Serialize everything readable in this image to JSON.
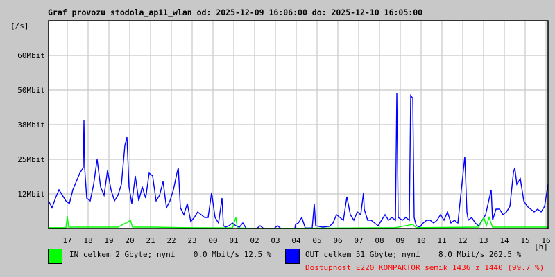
{
  "chart_data": {
    "type": "line",
    "title": "Graf provozu stodola_ap11_wlan od: 2025-12-09 16:06:00 do: 2025-12-10 16:05:00",
    "ylabel": "[/s]",
    "xlabel": "[h]",
    "x_units": "minutes since 16:06",
    "xlim": [
      0,
      1440
    ],
    "ylim": [
      0,
      75
    ],
    "y_unit": "Mbit/s",
    "grid": true,
    "yticks": [
      {
        "value": 12.5,
        "label": "12Mbit"
      },
      {
        "value": 25,
        "label": "25Mbit"
      },
      {
        "value": 37.5,
        "label": "38Mbit"
      },
      {
        "value": 50,
        "label": "50Mbit"
      },
      {
        "value": 62.5,
        "label": "60Mbit"
      }
    ],
    "xticks": [
      {
        "value": 54,
        "label": "17"
      },
      {
        "value": 114,
        "label": "18"
      },
      {
        "value": 174,
        "label": "19"
      },
      {
        "value": 234,
        "label": "20"
      },
      {
        "value": 294,
        "label": "21"
      },
      {
        "value": 354,
        "label": "22"
      },
      {
        "value": 414,
        "label": "23"
      },
      {
        "value": 474,
        "label": "00"
      },
      {
        "value": 534,
        "label": "01"
      },
      {
        "value": 594,
        "label": "02"
      },
      {
        "value": 654,
        "label": "03"
      },
      {
        "value": 714,
        "label": "04"
      },
      {
        "value": 774,
        "label": "05"
      },
      {
        "value": 834,
        "label": "06"
      },
      {
        "value": 894,
        "label": "07"
      },
      {
        "value": 954,
        "label": "08"
      },
      {
        "value": 1014,
        "label": "09"
      },
      {
        "value": 1074,
        "label": "10"
      },
      {
        "value": 1134,
        "label": "11"
      },
      {
        "value": 1194,
        "label": "12"
      },
      {
        "value": 1254,
        "label": "13"
      },
      {
        "value": 1314,
        "label": "14"
      },
      {
        "value": 1374,
        "label": "15"
      },
      {
        "value": 1434,
        "label": "16"
      }
    ],
    "series": [
      {
        "name": "OUT",
        "color": "#0000ff",
        "points": [
          [
            0,
            10
          ],
          [
            10,
            7.5
          ],
          [
            20,
            11
          ],
          [
            30,
            14
          ],
          [
            40,
            12
          ],
          [
            50,
            10
          ],
          [
            60,
            9
          ],
          [
            70,
            14
          ],
          [
            80,
            17
          ],
          [
            90,
            20
          ],
          [
            100,
            22
          ],
          [
            102,
            39
          ],
          [
            104,
            22
          ],
          [
            110,
            11
          ],
          [
            120,
            10
          ],
          [
            130,
            16
          ],
          [
            140,
            25
          ],
          [
            150,
            15
          ],
          [
            160,
            12
          ],
          [
            170,
            21
          ],
          [
            180,
            14
          ],
          [
            190,
            10
          ],
          [
            200,
            12
          ],
          [
            210,
            16
          ],
          [
            220,
            30
          ],
          [
            226,
            33
          ],
          [
            232,
            15
          ],
          [
            240,
            9
          ],
          [
            250,
            19
          ],
          [
            260,
            10
          ],
          [
            270,
            15
          ],
          [
            280,
            11
          ],
          [
            290,
            20
          ],
          [
            300,
            19
          ],
          [
            310,
            10
          ],
          [
            320,
            12
          ],
          [
            330,
            17
          ],
          [
            340,
            7.5
          ],
          [
            350,
            10
          ],
          [
            360,
            14
          ],
          [
            370,
            20
          ],
          [
            374,
            22
          ],
          [
            380,
            7.5
          ],
          [
            390,
            5
          ],
          [
            400,
            9
          ],
          [
            410,
            2.5
          ],
          [
            420,
            4
          ],
          [
            430,
            6
          ],
          [
            440,
            5
          ],
          [
            450,
            4
          ],
          [
            460,
            4
          ],
          [
            470,
            13
          ],
          [
            480,
            4
          ],
          [
            490,
            2
          ],
          [
            500,
            11
          ],
          [
            504,
            1
          ],
          [
            510,
            0.5
          ],
          [
            520,
            1
          ],
          [
            530,
            2
          ],
          [
            540,
            1
          ],
          [
            550,
            0.5
          ],
          [
            560,
            2
          ],
          [
            570,
            0
          ],
          [
            600,
            0
          ],
          [
            610,
            1
          ],
          [
            620,
            0
          ],
          [
            650,
            0
          ],
          [
            660,
            1
          ],
          [
            670,
            0
          ],
          [
            710,
            0
          ],
          [
            712,
            1.5
          ],
          [
            720,
            2
          ],
          [
            730,
            4
          ],
          [
            740,
            0.2
          ],
          [
            760,
            0.2
          ],
          [
            766,
            9
          ],
          [
            770,
            1
          ],
          [
            790,
            0.5
          ],
          [
            810,
            0.8
          ],
          [
            820,
            2
          ],
          [
            830,
            5
          ],
          [
            840,
            4
          ],
          [
            850,
            3
          ],
          [
            860,
            11.5
          ],
          [
            870,
            5
          ],
          [
            880,
            3
          ],
          [
            890,
            6
          ],
          [
            900,
            5
          ],
          [
            908,
            13
          ],
          [
            910,
            7
          ],
          [
            920,
            3
          ],
          [
            930,
            3
          ],
          [
            940,
            2
          ],
          [
            950,
            1
          ],
          [
            960,
            3
          ],
          [
            970,
            5
          ],
          [
            980,
            3
          ],
          [
            990,
            4
          ],
          [
            1000,
            3
          ],
          [
            1004,
            49
          ],
          [
            1008,
            4
          ],
          [
            1020,
            3
          ],
          [
            1030,
            4
          ],
          [
            1040,
            3
          ],
          [
            1044,
            48
          ],
          [
            1050,
            47
          ],
          [
            1054,
            4
          ],
          [
            1060,
            1
          ],
          [
            1070,
            0.5
          ],
          [
            1080,
            2
          ],
          [
            1090,
            3
          ],
          [
            1100,
            3
          ],
          [
            1110,
            2
          ],
          [
            1120,
            3
          ],
          [
            1130,
            5
          ],
          [
            1140,
            3
          ],
          [
            1150,
            6
          ],
          [
            1160,
            2
          ],
          [
            1170,
            3
          ],
          [
            1180,
            2
          ],
          [
            1200,
            26
          ],
          [
            1206,
            6
          ],
          [
            1210,
            3
          ],
          [
            1220,
            4
          ],
          [
            1230,
            2
          ],
          [
            1240,
            1
          ],
          [
            1250,
            3
          ],
          [
            1260,
            5
          ],
          [
            1276,
            14
          ],
          [
            1280,
            3
          ],
          [
            1290,
            7
          ],
          [
            1300,
            7
          ],
          [
            1310,
            5
          ],
          [
            1320,
            6
          ],
          [
            1330,
            8
          ],
          [
            1340,
            20
          ],
          [
            1344,
            22
          ],
          [
            1350,
            16
          ],
          [
            1360,
            18
          ],
          [
            1370,
            10
          ],
          [
            1380,
            8
          ],
          [
            1390,
            7
          ],
          [
            1400,
            6
          ],
          [
            1410,
            7
          ],
          [
            1420,
            6
          ],
          [
            1430,
            8
          ],
          [
            1440,
            16
          ]
        ]
      },
      {
        "name": "IN",
        "color": "#00ff00",
        "points": [
          [
            0,
            0.3
          ],
          [
            50,
            0.3
          ],
          [
            54,
            4.5
          ],
          [
            58,
            0.5
          ],
          [
            140,
            0.5
          ],
          [
            200,
            0.5
          ],
          [
            230,
            2.5
          ],
          [
            236,
            3
          ],
          [
            242,
            0.5
          ],
          [
            300,
            0.5
          ],
          [
            400,
            0.3
          ],
          [
            530,
            0.2
          ],
          [
            540,
            4
          ],
          [
            544,
            0.2
          ],
          [
            600,
            0
          ],
          [
            1000,
            0.3
          ],
          [
            1050,
            1.5
          ],
          [
            1060,
            0.3
          ],
          [
            1240,
            0.5
          ],
          [
            1255,
            4
          ],
          [
            1262,
            1
          ],
          [
            1270,
            4
          ],
          [
            1280,
            0.5
          ],
          [
            1300,
            0.5
          ],
          [
            1440,
            0.5
          ]
        ]
      }
    ]
  },
  "legend": {
    "in_text": "IN celkem 2 Gbyte; nyní    0.0 Mbit/s 12.5 %",
    "out_text": "OUT celkem 51 Gbyte; nyní    8.0 Mbit/s 262.5 %",
    "availability": "Dostupnost E220 KOMPAKTOR semik 1436 z 1440 (99.7 %)"
  }
}
